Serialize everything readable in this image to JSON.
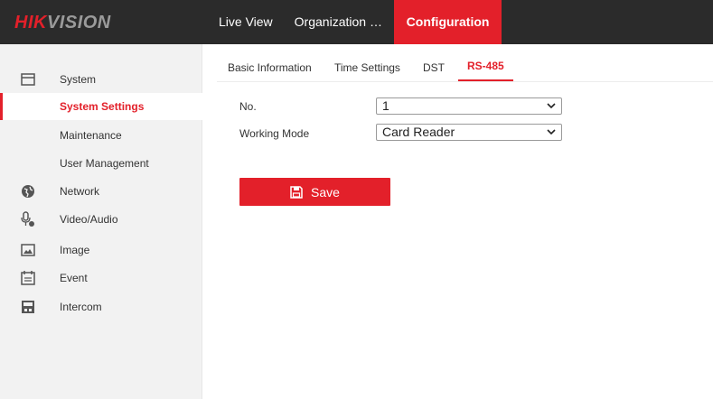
{
  "brand": {
    "part1": "HIK",
    "part2": "VISION"
  },
  "topnav": {
    "live_view": "Live View",
    "organization": "Organization Str…",
    "configuration": "Configuration"
  },
  "sidebar": {
    "items": [
      {
        "label": "System",
        "icon": "system-icon"
      },
      {
        "label": "System Settings",
        "selected": true
      },
      {
        "label": "Maintenance"
      },
      {
        "label": "User Management"
      },
      {
        "label": "Network",
        "icon": "network-icon"
      },
      {
        "label": "Video/Audio",
        "icon": "video-audio-icon"
      },
      {
        "label": "Image",
        "icon": "image-icon"
      },
      {
        "label": "Event",
        "icon": "event-icon"
      },
      {
        "label": "Intercom",
        "icon": "intercom-icon"
      }
    ]
  },
  "tabs": [
    {
      "label": "Basic Information"
    },
    {
      "label": "Time Settings"
    },
    {
      "label": "DST"
    },
    {
      "label": "RS-485",
      "active": true
    }
  ],
  "form": {
    "no_label": "No.",
    "no_value": "1",
    "mode_label": "Working Mode",
    "mode_value": "Card Reader"
  },
  "save_label": "Save",
  "colors": {
    "accent": "#e3202a",
    "topbar": "#2b2b2b",
    "sidebar": "#f2f2f2"
  }
}
